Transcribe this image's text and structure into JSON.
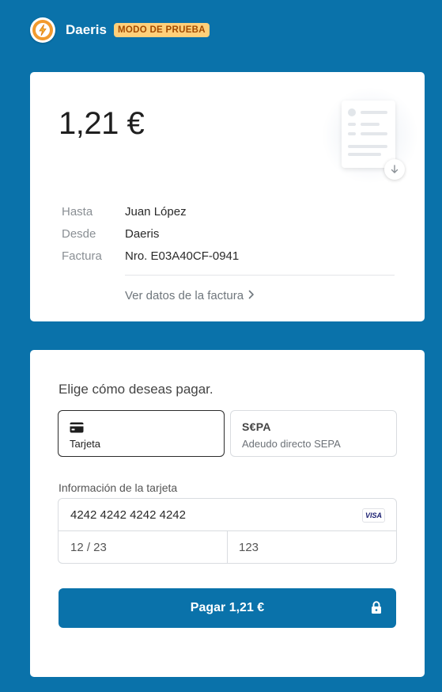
{
  "header": {
    "brand": "Daeris",
    "badge": "MODO DE PRUEBA",
    "logo_icon": "lightning-bolt-icon"
  },
  "invoice": {
    "amount": "1,21 €",
    "rows": [
      {
        "label": "Hasta",
        "value": "Juan López"
      },
      {
        "label": "Desde",
        "value": "Daeris"
      },
      {
        "label": "Factura",
        "value": "Nro. E03A40CF-0941"
      }
    ],
    "view_link": "Ver datos de la factura"
  },
  "payment": {
    "prompt": "Elige cómo deseas pagar.",
    "methods": [
      {
        "label": "Tarjeta",
        "icon": "credit-card-icon",
        "selected": true
      },
      {
        "label": "Adeudo directo SEPA",
        "logo": "S€PA",
        "selected": false
      }
    ],
    "card_section_label": "Información de la tarjeta",
    "card_number": "4242 4242 4242 4242",
    "card_brand": "VISA",
    "expiry": "12 / 23",
    "cvc": "123",
    "pay_button": "Pagar 1,21 €"
  },
  "colors": {
    "background": "#0a72aa",
    "badge_bg": "#ffd07a",
    "badge_text": "#a34a00",
    "button": "#0a72aa"
  }
}
